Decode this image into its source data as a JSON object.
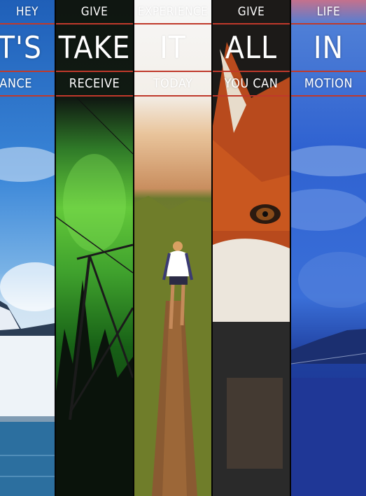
{
  "panels": [
    {
      "top": "HEY",
      "middle": "LET'S",
      "bottom": "DANCE",
      "accent": "#c0392b",
      "scene": "sky-mountain"
    },
    {
      "top": "GIVE",
      "middle": "TAKE",
      "bottom": "RECEIVE",
      "accent": "#c0392b",
      "scene": "aurora-powerline"
    },
    {
      "top": "EXPERIENCE",
      "middle": "IT",
      "bottom": "TODAY",
      "accent": "#c0392b",
      "scene": "trail-hiker"
    },
    {
      "top": "GIVE",
      "middle": "ALL",
      "bottom": "YOU CAN",
      "accent": "#c0392b",
      "scene": "fox"
    },
    {
      "top": "LIFE",
      "middle": "IN",
      "bottom": "MOTION",
      "accent": "#c0392b",
      "scene": "blue-sky-clouds"
    }
  ],
  "colors": {
    "frame_line": "#c0392b",
    "text": "#ffffff"
  }
}
